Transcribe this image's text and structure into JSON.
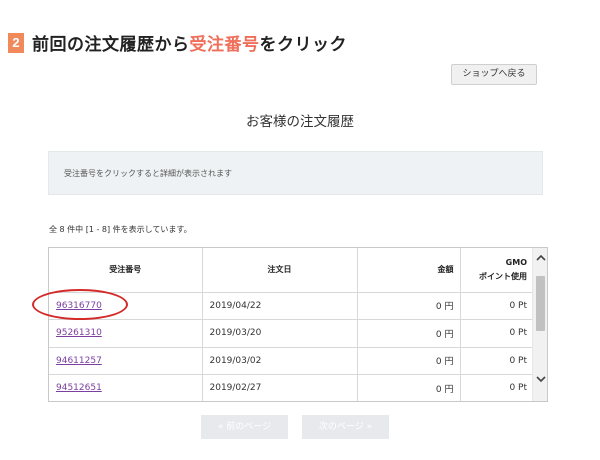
{
  "step": {
    "number": "2",
    "title_before": "前回の注文履歴から",
    "title_highlight": "受注番号",
    "title_after": "をクリック"
  },
  "header": {
    "back_button_label": "ショップへ戻る",
    "page_heading": "お客様の注文履歴"
  },
  "info": {
    "message": "受注番号をクリックすると詳細が表示されます"
  },
  "summary": {
    "count_text": "全 8 件中 [1 - 8] 件を表示しています。"
  },
  "table": {
    "headers": {
      "order_no": "受注番号",
      "order_date": "注文日",
      "amount": "金額",
      "points_line1": "GMO",
      "points_line2": "ポイント使用"
    },
    "rows": [
      {
        "order_no": "96316770",
        "date": "2019/04/22",
        "amount": "0 円",
        "points": "0 Pt"
      },
      {
        "order_no": "95261310",
        "date": "2019/03/20",
        "amount": "0 円",
        "points": "0 Pt"
      },
      {
        "order_no": "94611257",
        "date": "2019/03/02",
        "amount": "0 円",
        "points": "0 Pt"
      },
      {
        "order_no": "94512651",
        "date": "2019/02/27",
        "amount": "0 円",
        "points": "0 Pt"
      }
    ]
  },
  "pagination": {
    "prev_label": "« 前のページ",
    "next_label": "次のページ »"
  },
  "colors": {
    "accent": "#ef6f5a",
    "link": "#7b3fa0",
    "highlight_circle": "#d32a2a"
  }
}
